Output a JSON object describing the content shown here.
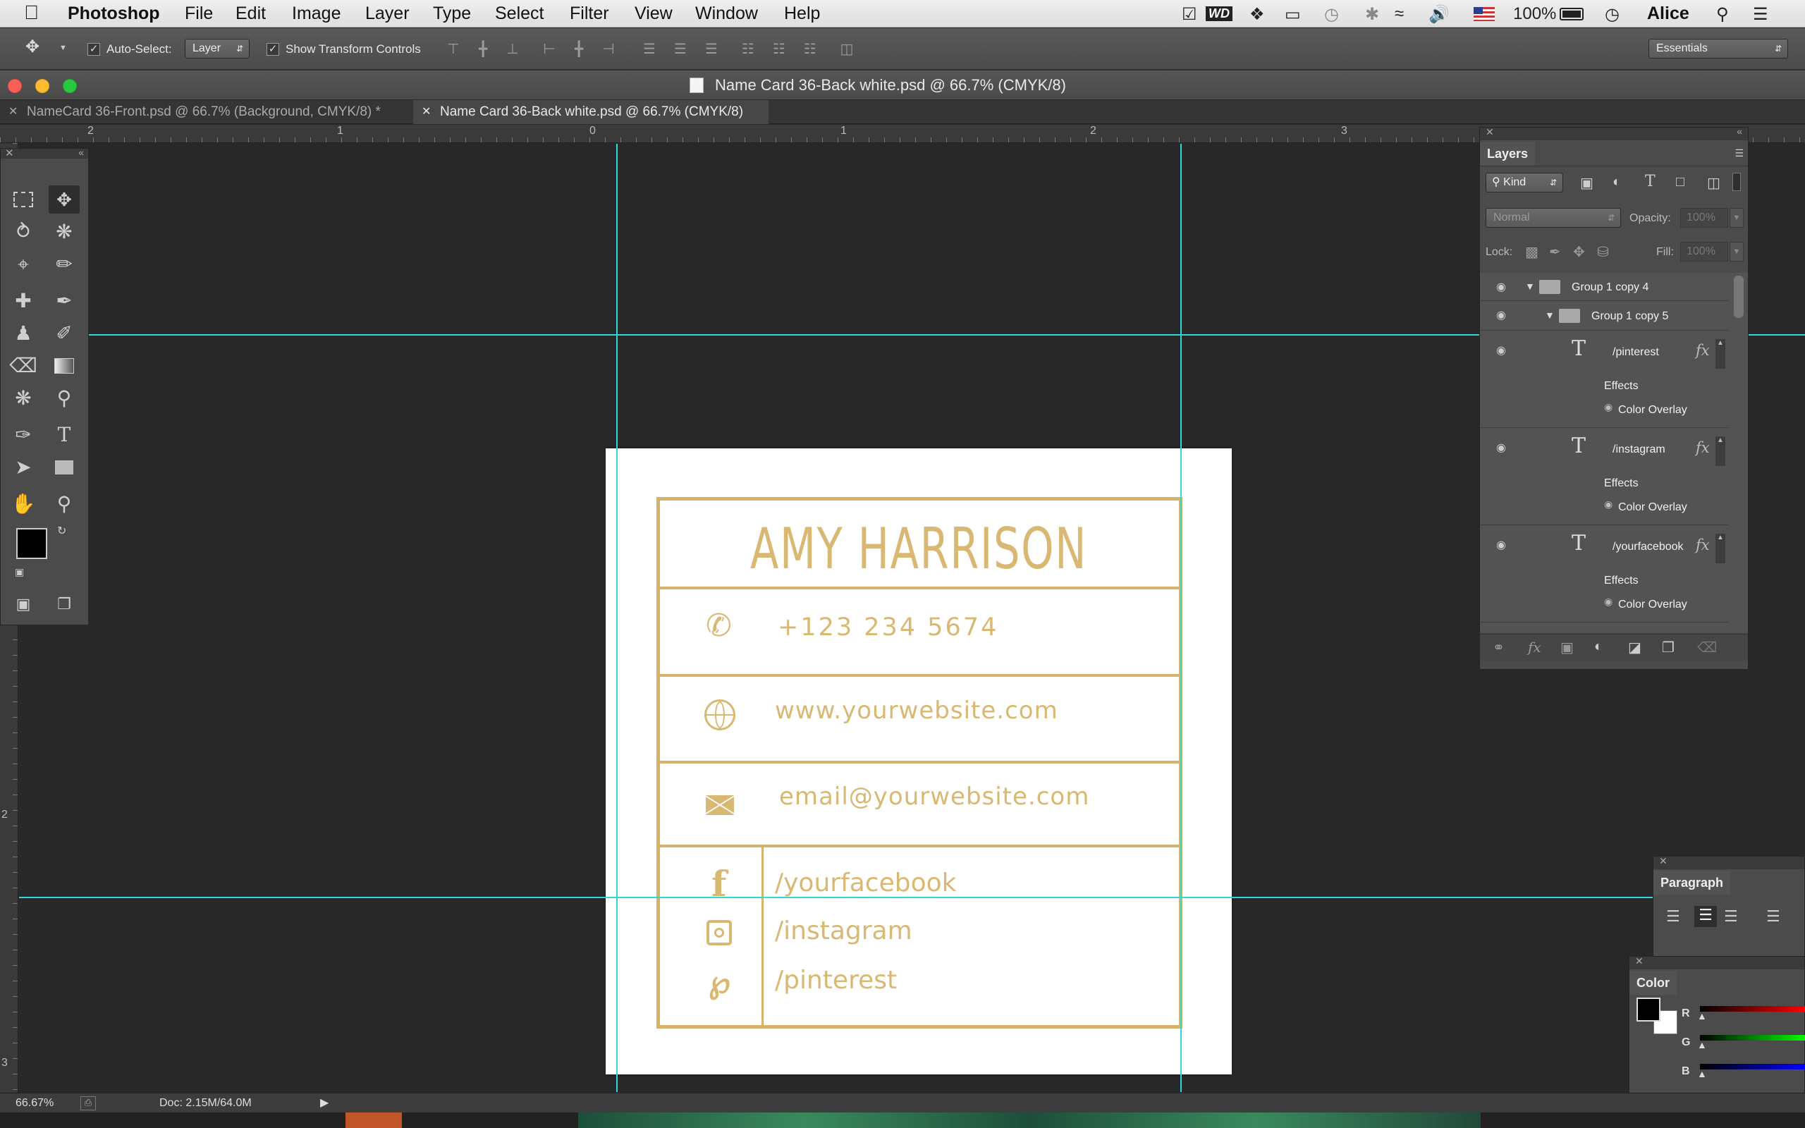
{
  "menubar": {
    "app_name": "Photoshop",
    "items": [
      "File",
      "Edit",
      "Image",
      "Layer",
      "Type",
      "Select",
      "Filter",
      "View",
      "Window",
      "Help"
    ],
    "battery": "100%",
    "user": "Alice"
  },
  "options": {
    "auto_select_label": "Auto-Select:",
    "auto_select_value": "Layer",
    "show_transform_label": "Show Transform Controls",
    "workspace": "Essentials"
  },
  "window": {
    "title": "Name Card 36-Back white.psd @ 66.7% (CMYK/8)"
  },
  "tabs": [
    {
      "label": "NameCard 36-Front.psd @ 66.7% (Background, CMYK/8) *"
    },
    {
      "label": "Name Card 36-Back white.psd @ 66.7% (CMYK/8)"
    }
  ],
  "ruler": {
    "top": [
      "2",
      "1",
      "0",
      "1",
      "2",
      "3"
    ],
    "left": [
      "2",
      "3"
    ]
  },
  "card": {
    "name": "AMY HARRISON",
    "phone": "+123 234 5674",
    "website": "www.yourwebsite.com",
    "email": "email@yourwebsite.com",
    "facebook": "/yourfacebook",
    "instagram": "/instagram",
    "pinterest": "/pinterest",
    "accent": "#d6b26a"
  },
  "layers": {
    "tab": "Layers",
    "filter_kind": "Kind",
    "blend_mode": "Normal",
    "opacity_label": "Opacity:",
    "opacity_value": "100%",
    "lock_label": "Lock:",
    "fill_label": "Fill:",
    "fill_value": "100%",
    "rows": [
      {
        "name": "Group 1 copy 4"
      },
      {
        "name": "Group 1 copy 5"
      },
      {
        "name": "/pinterest",
        "effects": "Effects",
        "effect": "Color Overlay"
      },
      {
        "name": "/instagram",
        "effects": "Effects",
        "effect": "Color Overlay"
      },
      {
        "name": "/yourfacebook",
        "effects": "Effects",
        "effect": "Color Overlay"
      }
    ]
  },
  "paragraph": {
    "tab": "Paragraph"
  },
  "color": {
    "tab": "Color",
    "r": "R",
    "g": "G",
    "b": "B"
  },
  "status": {
    "zoom": "66.67%",
    "doc": "Doc: 2.15M/64.0M"
  }
}
